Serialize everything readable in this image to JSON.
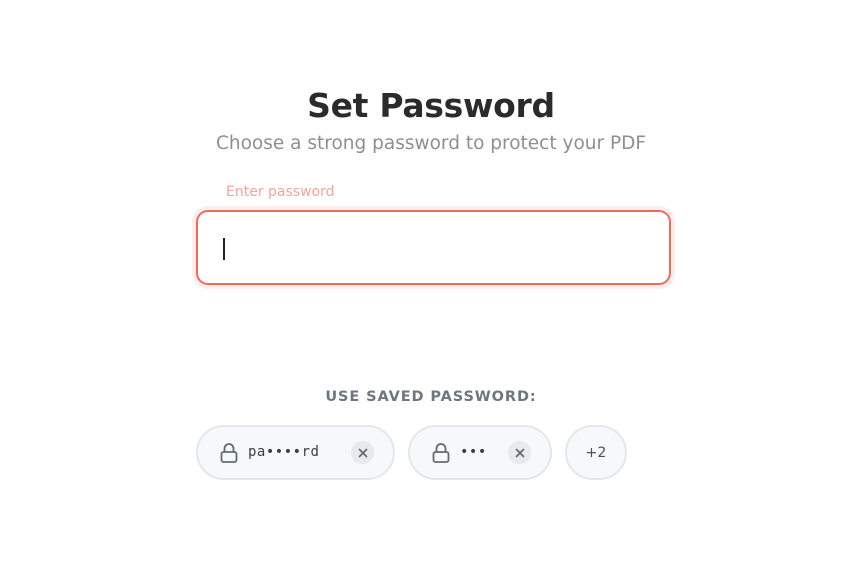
{
  "header": {
    "title": "Set Password",
    "subtitle": "Choose a strong password to protect your PDF"
  },
  "password_field": {
    "label": "Enter password",
    "value": ""
  },
  "saved_passwords": {
    "heading": "USE SAVED PASSWORD:",
    "items": [
      {
        "masked": "pa••••rd",
        "icon": "lock-icon"
      },
      {
        "masked": "•••",
        "icon": "lock-icon"
      }
    ],
    "more_label": "+2"
  },
  "colors": {
    "accent": "#ef6b5e",
    "label": "#f4a3a0",
    "heading": "#2b2b2b",
    "subtle": "#8f8f8f"
  }
}
